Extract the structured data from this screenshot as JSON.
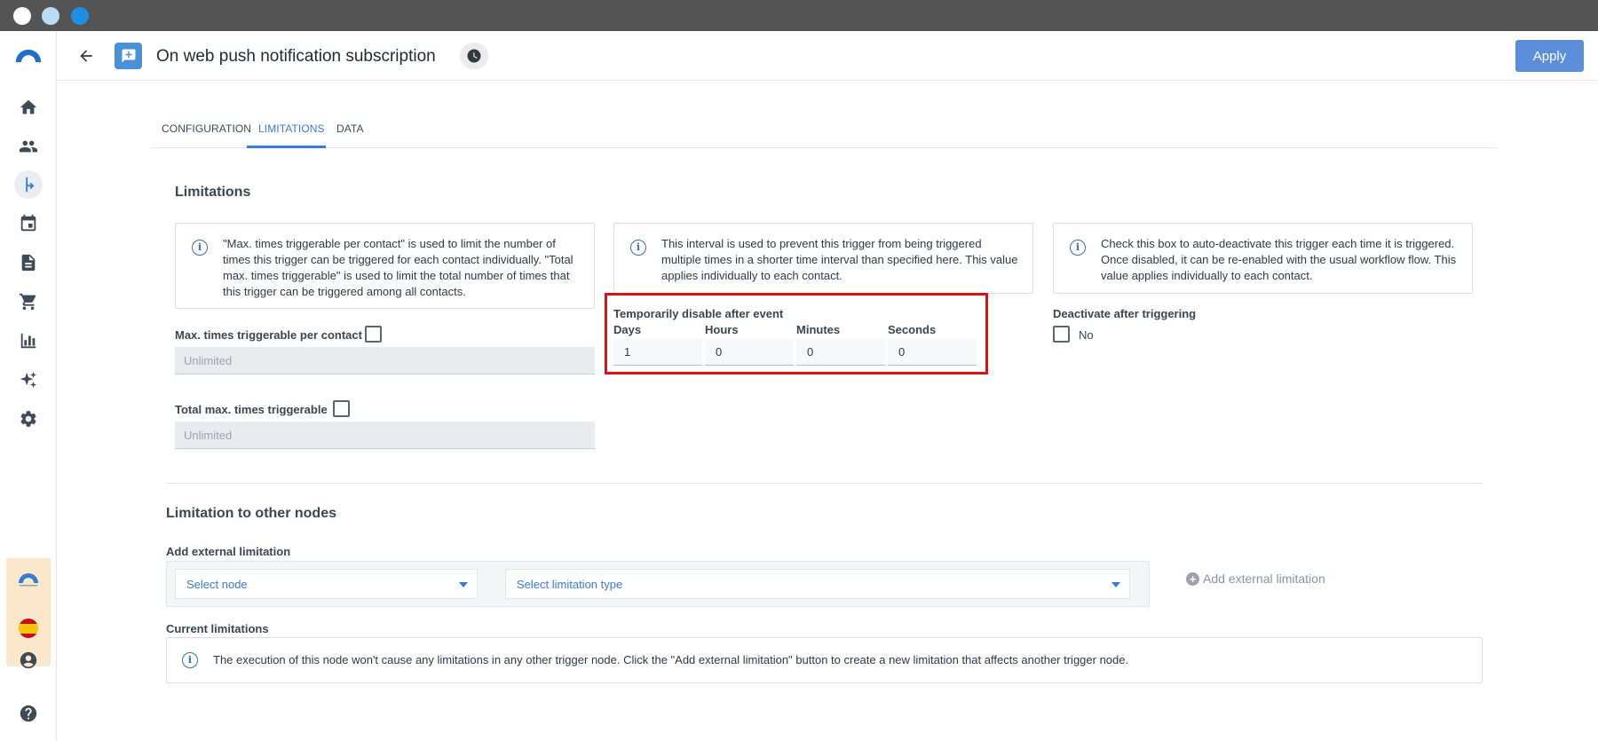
{
  "window": {
    "title": "On web push notification subscription"
  },
  "header": {
    "title": "On web push notification subscription",
    "apply_label": "Apply"
  },
  "sidebar": {
    "items": [
      {
        "name": "home",
        "icon": "home-icon"
      },
      {
        "name": "contacts",
        "icon": "people-icon"
      },
      {
        "name": "workflows",
        "icon": "workflow-icon",
        "active": true
      },
      {
        "name": "calendar",
        "icon": "calendar-icon"
      },
      {
        "name": "documents",
        "icon": "document-icon"
      },
      {
        "name": "shop",
        "icon": "cart-icon"
      },
      {
        "name": "analytics",
        "icon": "bar-chart-icon"
      },
      {
        "name": "ai",
        "icon": "sparkles-icon"
      },
      {
        "name": "settings",
        "icon": "gear-icon"
      },
      {
        "name": "account",
        "icon": "user-circle-icon"
      },
      {
        "name": "help",
        "icon": "help-icon"
      }
    ]
  },
  "tabs": [
    "CONFIGURATION",
    "LIMITATIONS",
    "DATA"
  ],
  "limitations": {
    "title": "Limitations",
    "info": [
      "\"Max. times triggerable per contact\" is used to limit the number of times this trigger can be triggered for each contact individually. \"Total max. times triggerable\" is used to limit the total number of times that this trigger can be triggered among all contacts.",
      "This interval is used to prevent this trigger from being triggered multiple times in a shorter time interval than specified here. This value applies individually to each contact.",
      "Check this box to auto-deactivate this trigger each time it is triggered. Once disabled, it can be re-enabled with the usual workflow flow. This value applies individually to each contact."
    ],
    "max_per_contact_label": "Max. times triggerable per contact",
    "max_per_contact_value": "Unlimited",
    "total_max_label": "Total max. times triggerable",
    "total_max_value": "Unlimited",
    "disable_label": "Temporarily disable after event",
    "time_labels": [
      "Days",
      "Hours",
      "Minutes",
      "Seconds"
    ],
    "time_values": [
      "1",
      "0",
      "0",
      "0"
    ],
    "deactivate_label": "Deactivate after triggering",
    "deactivate_value": "No"
  },
  "other_nodes": {
    "title": "Limitation to other nodes",
    "add_label": "Add external limitation",
    "select_node": "Select node",
    "select_type": "Select limitation type",
    "add_button": "Add external limitation",
    "current_label": "Current limitations",
    "current_info": "The execution of this node won't cause any limitations in any other trigger node. Click the \"Add external limitation\" button to create a new limitation that affects another trigger node."
  },
  "colors": {
    "accent": "#3a7bd5",
    "apply": "#5b8fdc",
    "highlight": "#d7141a"
  }
}
